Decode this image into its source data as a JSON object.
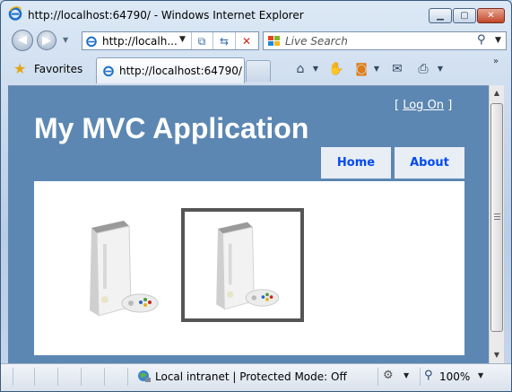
{
  "window": {
    "title": "http://localhost:64790/ - Windows Internet Explorer",
    "icons": [
      "ie-logo-icon",
      "minimize-icon",
      "maximize-icon",
      "close-icon"
    ]
  },
  "nav": {
    "address_value": "http://localh...",
    "search_placeholder": "Live Search"
  },
  "favorites_bar": {
    "favorites_label": "Favorites",
    "tab_label": "http://localhost:64790/"
  },
  "page": {
    "logon_open": "[",
    "logon_link": "Log On",
    "logon_close": "]",
    "site_title": "My MVC Application",
    "menu": [
      {
        "label": "Home"
      },
      {
        "label": "About"
      }
    ],
    "products": [
      {
        "icon": "xbox-360-console-image",
        "highlighted": false
      },
      {
        "icon": "xbox-360-console-image",
        "highlighted": true
      }
    ]
  },
  "status_bar": {
    "zone_text": "Local intranet | Protected Mode: Off",
    "zoom": "100%"
  },
  "colors": {
    "page_background": "#5c87b2",
    "menu_text": "#034af3",
    "menu_background": "#e8eef4",
    "highlight_border": "#555555"
  }
}
